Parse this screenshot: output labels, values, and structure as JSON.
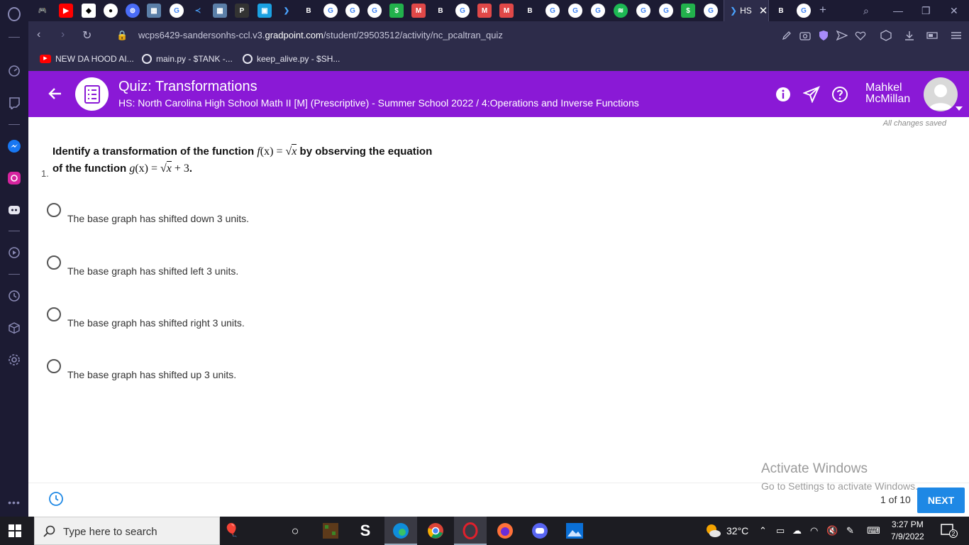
{
  "browser": {
    "url_prefix": "wcps6429-sandersonhs-ccl.v3.",
    "url_domain": "gradpoint.com",
    "url_path": "/student/29503512/activity/nc_pcaltran_quiz",
    "active_tab_title": "HS",
    "bookmarks": [
      {
        "label": "NEW DA HOOD AI..."
      },
      {
        "label": "main.py - $TANK -..."
      },
      {
        "label": "keep_alive.py - $SH..."
      }
    ]
  },
  "header": {
    "title": "Quiz: Transformations",
    "subtitle": "HS: North Carolina High School Math II [M] (Prescriptive) - Summer School 2022 / 4:Operations and Inverse Functions",
    "user_first": "Mahkel",
    "user_last": "McMillan"
  },
  "status": {
    "saved": "All changes saved"
  },
  "question": {
    "number": "1.",
    "line1_pre": "Identify a transformation of the function ",
    "f_name": "f",
    "f_eq": "(x) = ",
    "f_rad": "x",
    "line1_post": " by observing the equation",
    "line2_pre": "of the function ",
    "g_name": "g",
    "g_eq": "(x) = ",
    "g_rad": "x",
    "g_tail": " + 3",
    "line2_post": "."
  },
  "options": [
    {
      "label": "The base graph has shifted down 3 units."
    },
    {
      "label": "The base graph has shifted left 3 units."
    },
    {
      "label": "The base graph has shifted right 3 units."
    },
    {
      "label": "The base graph has shifted up 3 units."
    }
  ],
  "footer": {
    "progress": "1 of 10",
    "next_label": "NEXT"
  },
  "watermark": {
    "line1": "Activate Windows",
    "line2": "Go to Settings to activate Windows."
  },
  "taskbar": {
    "search_placeholder": "Type here to search",
    "temperature": "32°C",
    "time": "3:27 PM",
    "date": "7/9/2022",
    "notification_count": "2"
  },
  "colors": {
    "accent": "#8a19d6",
    "next_button": "#1e88e5",
    "chrome_dark": "#1c1b33",
    "chrome_bar": "#2d2c4a"
  }
}
